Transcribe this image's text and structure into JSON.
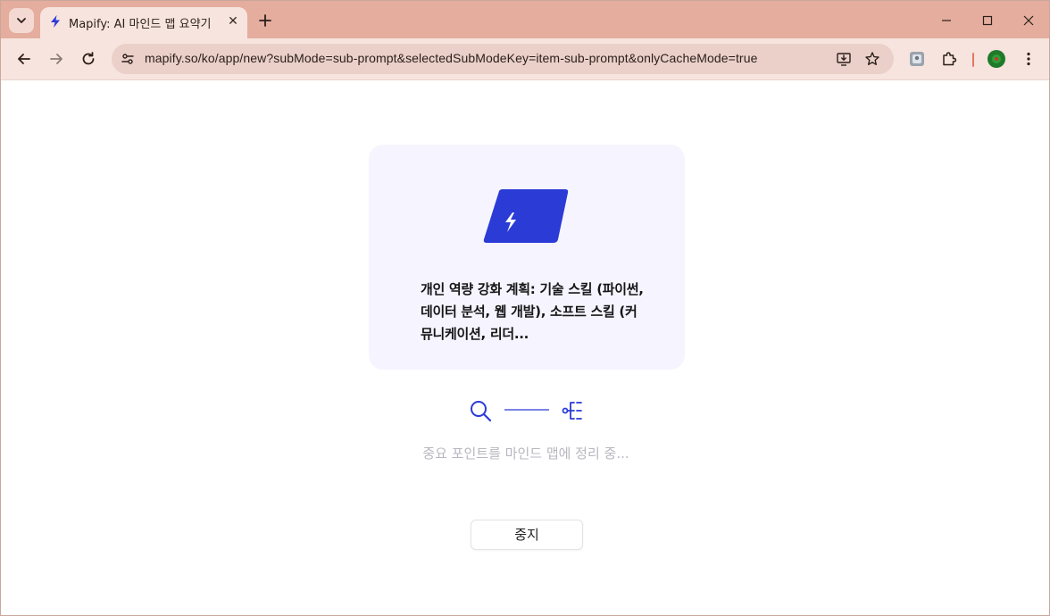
{
  "browser": {
    "tab": {
      "title": "Mapify: AI 마인드 맵 요약기",
      "close_glyph": "✕"
    },
    "address_bar": {
      "url": "mapify.so/ko/app/new?subMode=sub-prompt&selectedSubModeKey=item-sub-prompt&onlyCacheMode=true"
    },
    "colors": {
      "tabstrip": "#e4ad9d",
      "toolbar": "#f7e4de",
      "omnibox": "#ead0c8",
      "profile_avatar": "#1f7a2a"
    }
  },
  "app": {
    "card": {
      "title": "개인 역량 강화 계획: 기술 스킬 (파이썬, 데이터 분석, 웹 개발), 소프트 스킬 (커뮤니케이션, 리더..."
    },
    "status": "중요 포인트를 마인드 맵에 정리 중...",
    "stop_button": "중지",
    "colors": {
      "accent": "#2b3bd6",
      "card_bg": "#f6f5ff",
      "status_text": "#b7b7c0"
    },
    "icons": {
      "logo": "lightning-card-icon",
      "search": "search-icon",
      "mindmap": "mindmap-tree-icon"
    }
  }
}
